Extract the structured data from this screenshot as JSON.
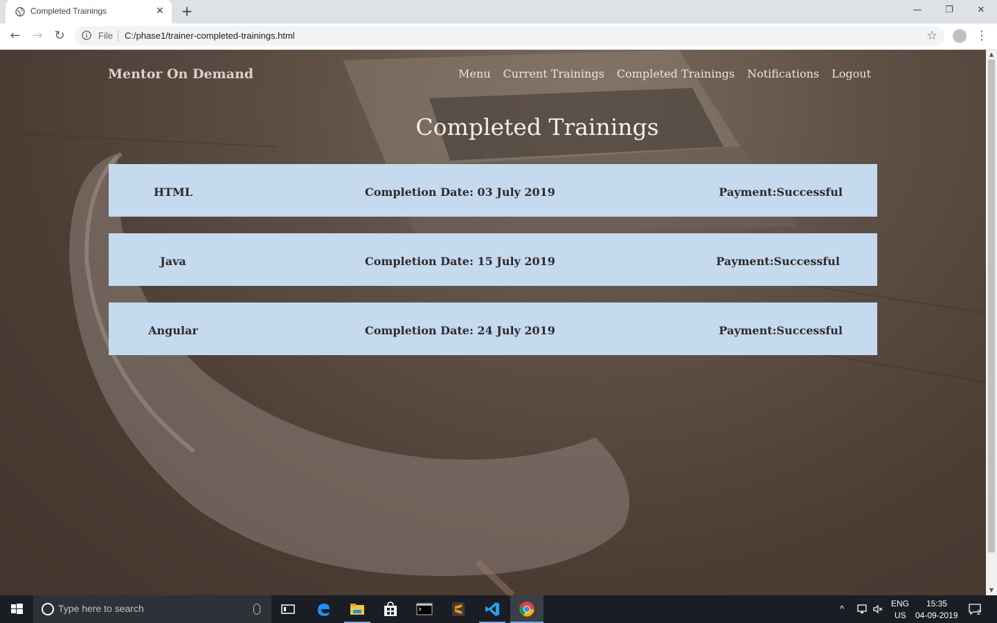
{
  "browser": {
    "tab_title": "Completed Trainings",
    "new_tab": "+",
    "file_label": "File",
    "url": "C:/phase1/trainer-completed-trainings.html"
  },
  "site": {
    "brand": "Mentor On Demand",
    "nav": [
      "Menu",
      "Current Trainings",
      "Completed Trainings",
      "Notifications",
      "Logout"
    ]
  },
  "page": {
    "title": "Completed Trainings",
    "trainings": [
      {
        "name": "HTML",
        "date": "Completion Date: 03 July 2019",
        "payment": "Payment:Successful"
      },
      {
        "name": "Java",
        "date": "Completion Date: 15 July 2019",
        "payment": "Payment:Successful"
      },
      {
        "name": "Angular",
        "date": "Completion Date: 24 July 2019",
        "payment": "Payment:Successful"
      }
    ]
  },
  "taskbar": {
    "search_placeholder": "Type here to search",
    "lang_top": "ENG",
    "lang_bottom": "US",
    "time": "15:35",
    "date": "04-09-2019",
    "notification_count": "2"
  },
  "colors": {
    "card_bg": "#c5d9ef",
    "page_overlay": "#4b3e35"
  }
}
